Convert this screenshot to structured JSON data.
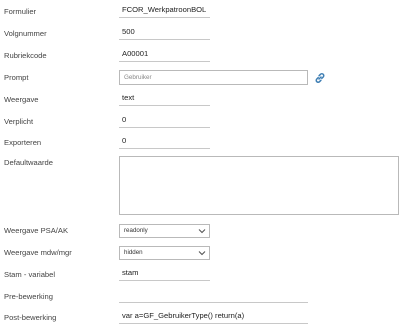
{
  "fields": {
    "formulier": {
      "label": "Formulier",
      "value": "FCOR_WerkpatroonBOL"
    },
    "volgnummer": {
      "label": "Volgnummer",
      "value": "500"
    },
    "rubriekcode": {
      "label": "Rubriekcode",
      "value": "A00001"
    },
    "prompt": {
      "label": "Prompt",
      "placeholder": "Gebruiker",
      "icon": "link-icon"
    },
    "weergave": {
      "label": "Weergave",
      "value": "text"
    },
    "verplicht": {
      "label": "Verplicht",
      "value": "0"
    },
    "exporteren": {
      "label": "Exporteren",
      "value": "0"
    },
    "defaultwaarde": {
      "label": "Defaultwaarde",
      "value": ""
    },
    "weergave_psa_ak": {
      "label": "Weergave PSA/AK",
      "selected": "readonly",
      "icon": "chevron-down-icon"
    },
    "weergave_mdw_mgr": {
      "label": "Weergave mdw/mgr",
      "selected": "hidden",
      "icon": "chevron-down-icon"
    },
    "stam_variabel": {
      "label": "Stam - variabel",
      "value": "stam"
    },
    "pre_bewerking": {
      "label": "Pre-bewerking",
      "value": ""
    },
    "post_bewerking": {
      "label": "Post-bewerking",
      "value": "var a=GF_GebruikerType() return(a)"
    }
  },
  "colors": {
    "text": "#333333",
    "border": "#b9b9b9",
    "underline": "#c8c8c8",
    "icon": "#3f7fb4"
  }
}
